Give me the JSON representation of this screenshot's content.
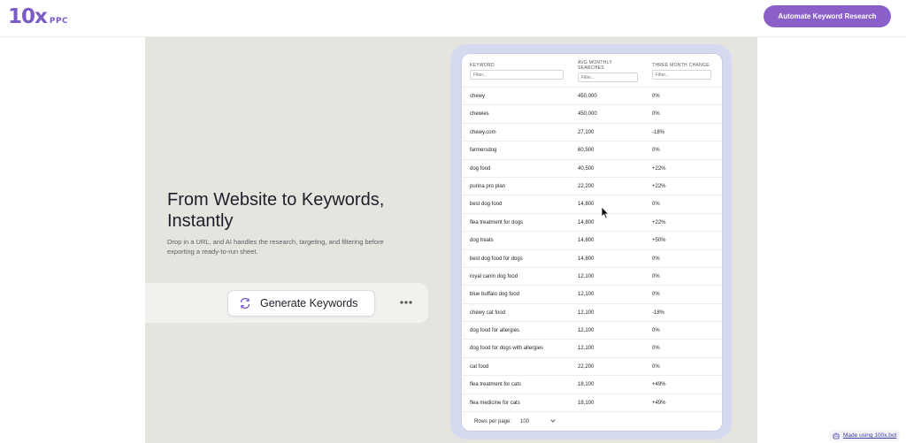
{
  "header": {
    "logo_main": "10x",
    "logo_sub": "PPC",
    "cta_label": "Automate Keyword Research"
  },
  "hero": {
    "title": "From Website to Keywords, Instantly",
    "subtitle": "Drop in a URL, and AI handles the research, targeting, and filtering before exporting a ready-to-run sheet.",
    "generate_label": "Generate Keywords",
    "more_icon": "more-horizontal-icon"
  },
  "table": {
    "columns": [
      {
        "header": "KEYWORD",
        "filter_placeholder": "Filter..."
      },
      {
        "header": "AVG MONTHLY SEARCHES",
        "filter_placeholder": "Filter..."
      },
      {
        "header": "THREE MONTH CHANGE",
        "filter_placeholder": "Filter..."
      }
    ],
    "rows": [
      [
        "chewy",
        "450,000",
        "0%"
      ],
      [
        "chewies",
        "450,000",
        "0%"
      ],
      [
        "chewy.com",
        "27,100",
        "-18%"
      ],
      [
        "farmersdog",
        "60,500",
        "0%"
      ],
      [
        "dog food",
        "40,500",
        "+22%"
      ],
      [
        "purina pro plan",
        "22,200",
        "+22%"
      ],
      [
        "best dog food",
        "14,800",
        "0%"
      ],
      [
        "flea treatment for dogs",
        "14,800",
        "+22%"
      ],
      [
        "dog treats",
        "14,800",
        "+50%"
      ],
      [
        "best dog food for dogs",
        "14,800",
        "0%"
      ],
      [
        "royal canin dog food",
        "12,100",
        "0%"
      ],
      [
        "blue buffalo dog food",
        "12,100",
        "0%"
      ],
      [
        "chewy cat food",
        "12,100",
        "-18%"
      ],
      [
        "dog food for allergies",
        "12,100",
        "0%"
      ],
      [
        "dog food for dogs with allergies",
        "12,100",
        "0%"
      ],
      [
        "cat food",
        "22,200",
        "0%"
      ],
      [
        "flea treatment for cats",
        "18,100",
        "+49%"
      ],
      [
        "flea medicine for cats",
        "18,100",
        "+49%"
      ]
    ],
    "pager_label": "Rows per page:",
    "pager_value": "100"
  },
  "footer": {
    "badge_label": "Made using 100x.bot"
  },
  "colors": {
    "brand": "#8a5fc8",
    "hero_bg": "#e6e4df",
    "table_frame": "#d6daf0"
  }
}
